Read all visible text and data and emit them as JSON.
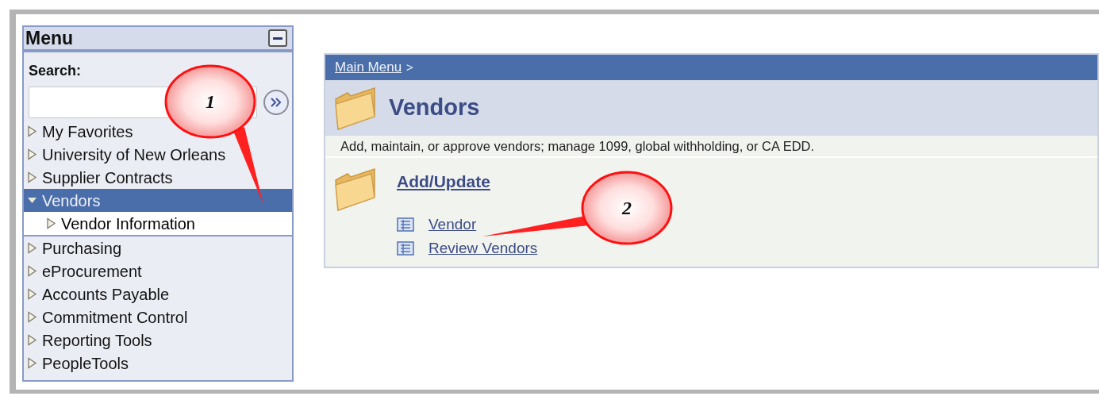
{
  "menu": {
    "title": "Menu",
    "search": {
      "label": "Search:"
    },
    "items": [
      {
        "label": "My Favorites",
        "expanded": false,
        "selected": false
      },
      {
        "label": "University of New Orleans",
        "expanded": false,
        "selected": false
      },
      {
        "label": "Supplier Contracts",
        "expanded": false,
        "selected": false
      },
      {
        "label": "Vendors",
        "expanded": true,
        "selected": true,
        "children": [
          {
            "label": "Vendor Information",
            "expanded": false,
            "selected": false
          }
        ]
      },
      {
        "label": "Purchasing",
        "expanded": false,
        "selected": false
      },
      {
        "label": "eProcurement",
        "expanded": false,
        "selected": false
      },
      {
        "label": "Accounts Payable",
        "expanded": false,
        "selected": false
      },
      {
        "label": "Commitment Control",
        "expanded": false,
        "selected": false
      },
      {
        "label": "Reporting Tools",
        "expanded": false,
        "selected": false
      },
      {
        "label": "PeopleTools",
        "expanded": false,
        "selected": false
      }
    ]
  },
  "content": {
    "breadcrumb": "Main Menu",
    "breadcrumb_separator": ">",
    "title": "Vendors",
    "description": "Add, maintain, or approve vendors; manage 1099, global withholding, or CA EDD.",
    "section": {
      "title": "Add/Update",
      "links": [
        "Vendor",
        "Review Vendors"
      ]
    }
  },
  "callouts": [
    {
      "number": "1"
    },
    {
      "number": "2"
    }
  ]
}
